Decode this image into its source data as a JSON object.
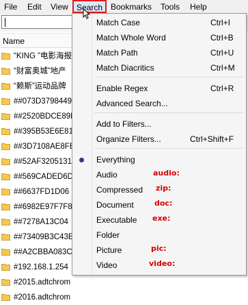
{
  "menubar": {
    "items": [
      "File",
      "Edit",
      "View",
      "Search",
      "Bookmarks",
      "Tools",
      "Help"
    ]
  },
  "file_list": {
    "header": "Name",
    "rows": [
      "“KING ”电影海报",
      "“财富奥城”地产",
      "“赖斯”运动品牌",
      "##073D3798449",
      "##2520BDCE89D",
      "##395B53E6E81",
      "##3D7108AE8FE",
      "##52AF3205131",
      "##569CADED6D",
      "##6637FD1D06",
      "##6982E97F7F8",
      "##7278A13C04",
      "##73409B3C43B",
      "##A2CBBA083C",
      "#192.168.1.254",
      "#2015.adtchrom",
      "#2016.adtchrom"
    ]
  },
  "search_menu": {
    "items": [
      {
        "label": "Match Case",
        "shortcut": "Ctrl+I"
      },
      {
        "label": "Match Whole Word",
        "shortcut": "Ctrl+B"
      },
      {
        "label": "Match Path",
        "shortcut": "Ctrl+U"
      },
      {
        "label": "Match Diacritics",
        "shortcut": "Ctrl+M"
      },
      {
        "label": "Enable Regex",
        "shortcut": "Ctrl+R"
      },
      {
        "label": "Advanced Search...",
        "shortcut": ""
      },
      {
        "label": "Add to Filters...",
        "shortcut": ""
      },
      {
        "label": "Organize Filters...",
        "shortcut": "Ctrl+Shift+F"
      },
      {
        "label": "Everything",
        "shortcut": ""
      },
      {
        "label": "Audio",
        "shortcut": ""
      },
      {
        "label": "Compressed",
        "shortcut": ""
      },
      {
        "label": "Document",
        "shortcut": ""
      },
      {
        "label": "Executable",
        "shortcut": ""
      },
      {
        "label": "Folder",
        "shortcut": ""
      },
      {
        "label": "Picture",
        "shortcut": ""
      },
      {
        "label": "Video",
        "shortcut": ""
      }
    ],
    "selected": "Everything"
  },
  "annotations": [
    "audio:",
    "zip:",
    "doc:",
    "exe:",
    "pic:",
    "video:"
  ],
  "colors": {
    "highlight_border": "#e01b1b",
    "annotation_text": "#d40000",
    "folder_yellow": "#f3c94f"
  }
}
